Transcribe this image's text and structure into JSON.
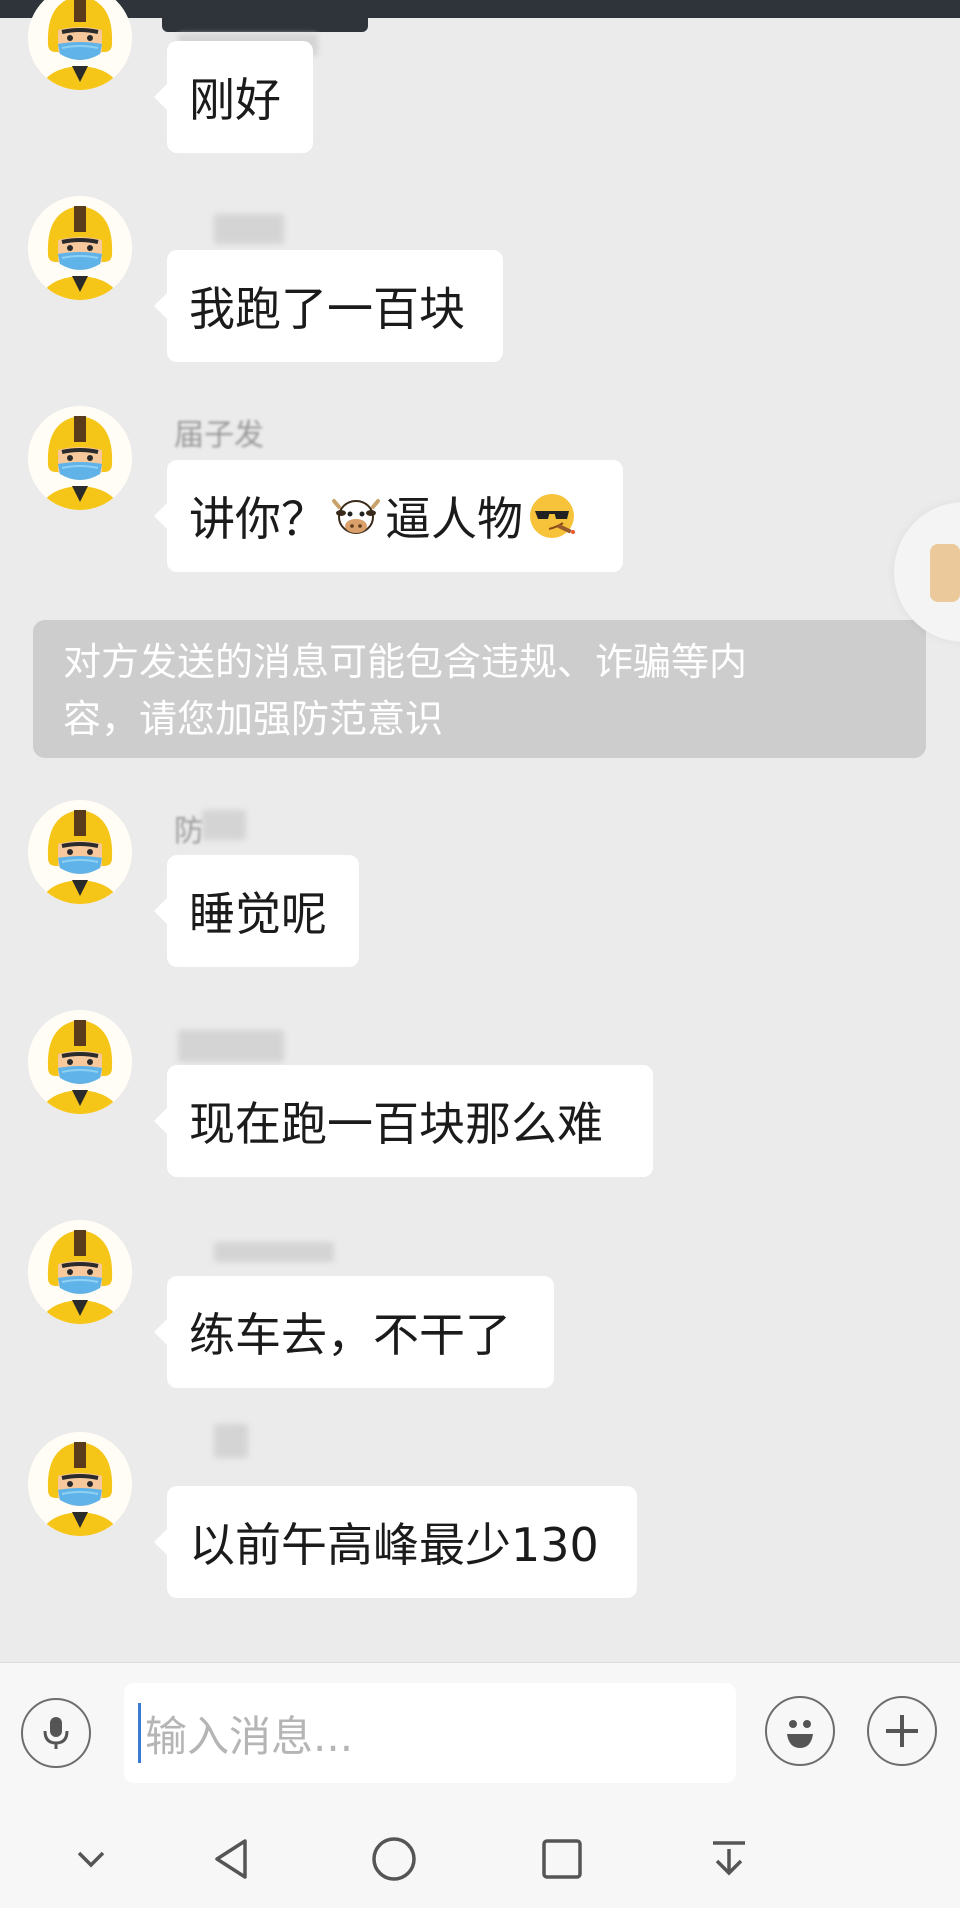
{
  "messages": [
    {
      "text": "刚好"
    },
    {
      "text": "我跑了一百块"
    },
    {
      "sender": "届子发",
      "text_before": "讲你？",
      "emoji_1": "cow-face-icon",
      "text_middle": "逼人物",
      "emoji_2": "smirk-sunglasses-cigar-icon"
    },
    {
      "sender": "防",
      "text": "睡觉呢"
    },
    {
      "text": "现在跑一百块那么难"
    },
    {
      "text": "练车去，不干了"
    },
    {
      "text": "以前午高峰最少130"
    }
  ],
  "warning": {
    "line1": "对方发送的消息可能包含违规、诈骗等内",
    "line2": "容，请您加强防范意识"
  },
  "input": {
    "placeholder": "输入消息..."
  },
  "icons": {
    "voice": "microphone-icon",
    "emoji": "smiley-icon",
    "more": "plus-icon",
    "nav": [
      "chevron-down-icon",
      "back-triangle-icon",
      "home-circle-icon",
      "recents-square-icon",
      "pull-down-icon"
    ]
  },
  "colors": {
    "background": "#ebebeb",
    "bubble": "#ffffff",
    "warning": "#cdcdcd",
    "avatar_helmet": "#f5c518",
    "mask": "#5fb3e8"
  }
}
